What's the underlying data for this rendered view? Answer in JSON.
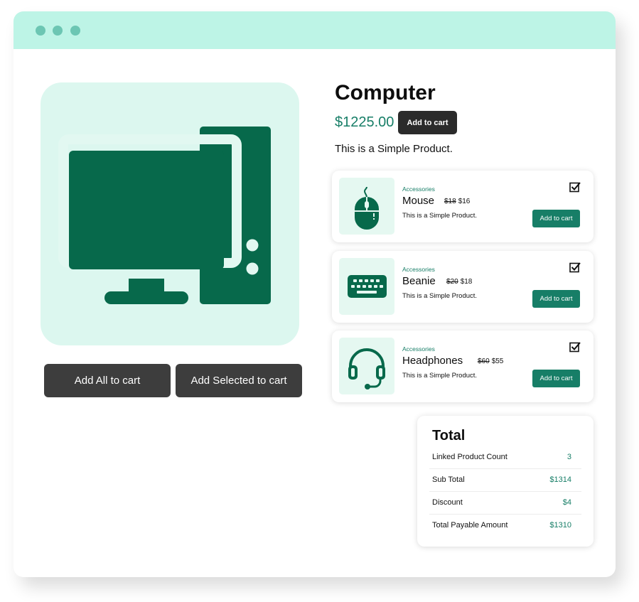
{
  "product": {
    "title": "Computer",
    "price": "$1225.00",
    "add_to_cart_label": "Add to cart",
    "description": "This is a Simple Product."
  },
  "actions": {
    "add_all_label": "Add All to cart",
    "add_selected_label": "Add Selected to cart"
  },
  "linked_products": [
    {
      "category": "Accessories",
      "name": "Mouse",
      "old_price": "$18",
      "price": "$16",
      "description": "This is a Simple Product.",
      "add_label": "Add to cart",
      "icon": "mouse-icon",
      "checked": true
    },
    {
      "category": "Accessories",
      "name": "Beanie",
      "old_price": "$20",
      "price": "$18",
      "description": "This is a Simple Product.",
      "add_label": "Add to cart",
      "icon": "keyboard-icon",
      "checked": true
    },
    {
      "category": "Accessories",
      "name": "Headphones",
      "old_price": "$60",
      "price": "$55",
      "description": "This is a Simple Product.",
      "add_label": "Add to cart",
      "icon": "headphones-icon",
      "checked": true
    }
  ],
  "totals": {
    "title": "Total",
    "rows": [
      {
        "label": "Linked Product Count",
        "value": "3"
      },
      {
        "label": "Sub Total",
        "value": "$1314"
      },
      {
        "label": "Discount",
        "value": "$4"
      },
      {
        "label": "Total Payable Amount",
        "value": "$1310"
      }
    ]
  },
  "colors": {
    "accent": "#177e67",
    "titlebar": "#bdf4e6",
    "hero_bg": "#dcf7ef",
    "icon": "#07694b",
    "dark_button": "#3d3d3d"
  }
}
